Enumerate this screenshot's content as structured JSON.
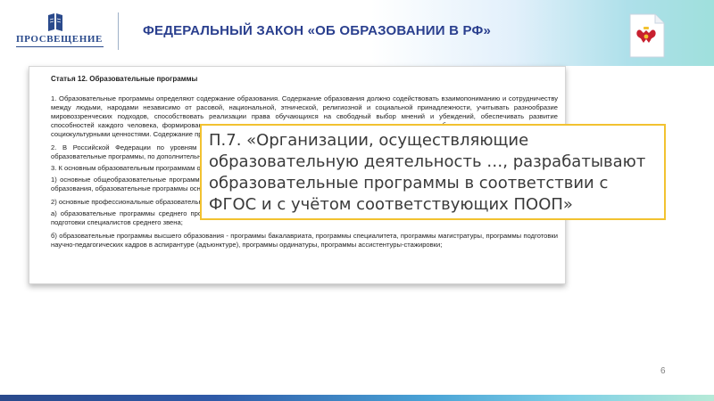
{
  "header": {
    "logo_text": "ПРОСВЕЩЕНИЕ",
    "title": "ФЕДЕРАЛЬНЫЙ ЗАКОН «ОБ ОБРАЗОВАНИИ В РФ»"
  },
  "document": {
    "heading": "Статья 12. Образовательные программы",
    "paragraphs": [
      "1. Образовательные программы определяют содержание образования. Содержание образования должно содействовать взаимопониманию и сотрудничеству между людьми, народами независимо от расовой, национальной, этнической, религиозной и социальной принадлежности, учитывать разнообразие мировоззренческих подходов, способствовать реализации права обучающихся на свободный выбор мнений и убеждений, обеспечивать развитие способностей каждого человека, формирование и развитие его личности в соответствии с принятыми в семье и обществе духовно-нравственными и социокультурными ценностями. Содержание профессионального образования и профессионального обучения должно обеспечивать получение квалификации.",
      "2. В Российской Федерации по уровням общего и профессионального образования, по профессиональному обучению реализуются основные образовательные программы, по дополнительному образованию - дополнительные образовательные программы.",
      "3. К основным образовательным программам относятся:",
      "1) основные общеобразовательные программы - образовательные программы дошкольного образования, образовательные программы начального общего образования, образовательные программы основного общего образования, образовательные программы среднего общего образования;",
      "2) основные профессиональные образовательные программы:",
      "а) образовательные программы среднего профессионального образования - программы подготовки квалифицированных рабочих, служащих, программы подготовки специалистов среднего звена;",
      "б) образовательные программы высшего образования - программы бакалавриата, программы специалитета, программы магистратуры, программы подготовки научно-педагогических кадров в аспирантуре (адъюнктуре), программы ординатуры, программы ассистентуры-стажировки;"
    ]
  },
  "callout": {
    "text": "П.7. «Организации, осуществляющие образовательную деятельность …, разрабатывают образовательные программы в соответствии с ФГОС и с учётом соответствующих ПООП»"
  },
  "page_number": "6",
  "colors": {
    "title": "#2a3f8e",
    "callout_border": "#f2c230",
    "bottom_bar_start": "#2a4a8c",
    "bottom_bar_end": "#b6ead7"
  }
}
